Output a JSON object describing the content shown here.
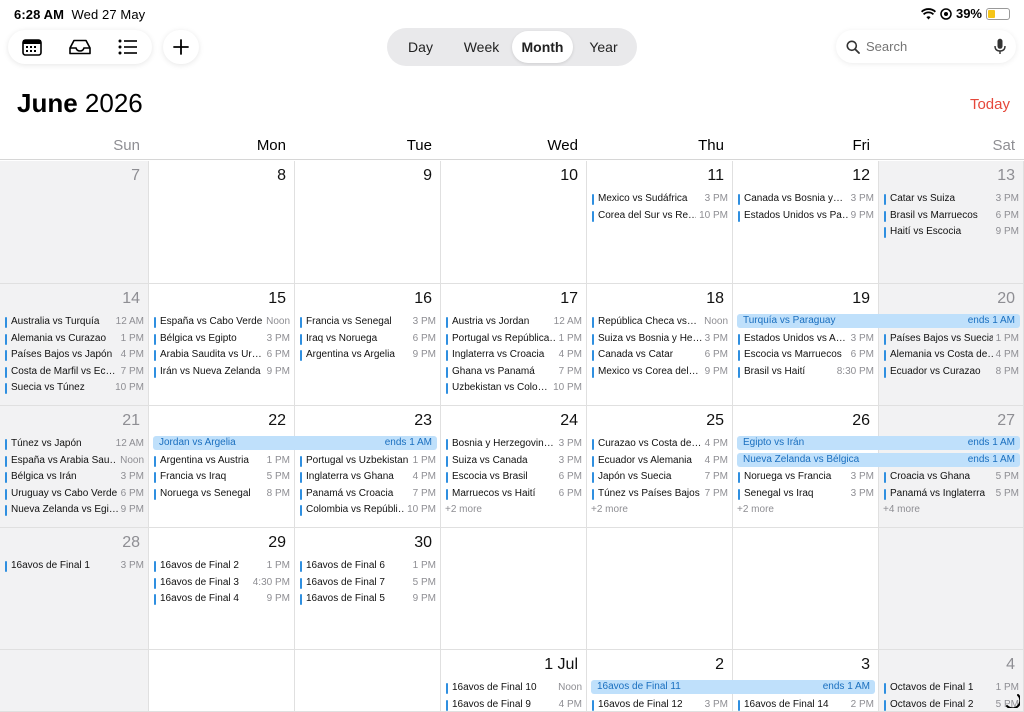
{
  "status_bar": {
    "time": "6:28 AM",
    "date": "Wed 27 May",
    "battery": "39%",
    "battery_level": 0.39
  },
  "toolbar": {
    "icons": [
      "calendar-icon",
      "inbox-icon",
      "list-icon"
    ],
    "add_icon": "plus-icon"
  },
  "view_switcher": {
    "options": [
      "Day",
      "Week",
      "Month",
      "Year"
    ],
    "selected": "Month"
  },
  "search": {
    "placeholder": "Search"
  },
  "header": {
    "month": "June",
    "year": "2026",
    "today_label": "Today"
  },
  "weekdays": [
    "Sun",
    "Mon",
    "Tue",
    "Wed",
    "Thu",
    "Fri",
    "Sat"
  ],
  "weeks": [
    {
      "days": [
        {
          "n": "7",
          "events": []
        },
        {
          "n": "8",
          "events": []
        },
        {
          "n": "9",
          "events": []
        },
        {
          "n": "10",
          "events": []
        },
        {
          "n": "11",
          "events": [
            {
              "t": "Mexico vs Sudáfrica",
              "tm": "3 PM"
            },
            {
              "t": "Corea del Sur vs Re…",
              "tm": "10 PM"
            }
          ]
        },
        {
          "n": "12",
          "events": [
            {
              "t": "Canada vs Bosnia y…",
              "tm": "3 PM"
            },
            {
              "t": "Estados Unidos vs Pa…",
              "tm": "9 PM"
            }
          ]
        },
        {
          "n": "13",
          "events": [
            {
              "t": "Catar vs Suiza",
              "tm": "3 PM"
            },
            {
              "t": "Brasil vs Marruecos",
              "tm": "6 PM"
            },
            {
              "t": "Haití vs Escocia",
              "tm": "9 PM"
            }
          ]
        }
      ],
      "spans": []
    },
    {
      "days": [
        {
          "n": "14",
          "events": [
            {
              "t": "Australia vs Turquía",
              "tm": "12 AM"
            },
            {
              "t": "Alemania vs Curazao",
              "tm": "1 PM"
            },
            {
              "t": "Países Bajos vs Japón",
              "tm": "4 PM"
            },
            {
              "t": "Costa de Marfil vs Ec…",
              "tm": "7 PM"
            },
            {
              "t": "Suecia vs Túnez",
              "tm": "10 PM"
            }
          ]
        },
        {
          "n": "15",
          "events": [
            {
              "t": "España vs Cabo Verde",
              "tm": "Noon"
            },
            {
              "t": "Bélgica vs Egipto",
              "tm": "3 PM"
            },
            {
              "t": "Arabia Saudita vs Ur…",
              "tm": "6 PM"
            },
            {
              "t": "Irán vs Nueva Zelanda",
              "tm": "9 PM"
            }
          ]
        },
        {
          "n": "16",
          "events": [
            {
              "t": "Francia vs Senegal",
              "tm": "3 PM"
            },
            {
              "t": "Iraq vs Noruega",
              "tm": "6 PM"
            },
            {
              "t": "Argentina vs Argelia",
              "tm": "9 PM"
            }
          ]
        },
        {
          "n": "17",
          "events": [
            {
              "t": "Austria vs Jordan",
              "tm": "12 AM"
            },
            {
              "t": "Portugal vs República…",
              "tm": "1 PM"
            },
            {
              "t": "Inglaterra vs Croacia",
              "tm": "4 PM"
            },
            {
              "t": "Ghana vs Panamá",
              "tm": "7 PM"
            },
            {
              "t": "Uzbekistan vs Colo…",
              "tm": "10 PM"
            }
          ]
        },
        {
          "n": "18",
          "events": [
            {
              "t": "República Checa vs…",
              "tm": "Noon"
            },
            {
              "t": "Suiza vs Bosnia y He…",
              "tm": "3 PM"
            },
            {
              "t": "Canada vs Catar",
              "tm": "6 PM"
            },
            {
              "t": "Mexico vs Corea del…",
              "tm": "9 PM"
            }
          ]
        },
        {
          "n": "19",
          "events": [
            {
              "t": "Estados Unidos vs A…",
              "tm": "3 PM"
            },
            {
              "t": "Escocia vs Marruecos",
              "tm": "6 PM"
            },
            {
              "t": "Brasil vs Haití",
              "tm": "8:30 PM"
            }
          ]
        },
        {
          "n": "20",
          "events": [
            {
              "t": "Países Bajos vs Suecia",
              "tm": "1 PM"
            },
            {
              "t": "Alemania vs Costa de…",
              "tm": "4 PM"
            },
            {
              "t": "Ecuador vs Curazao",
              "tm": "8 PM"
            }
          ]
        }
      ],
      "spans": [
        {
          "t": "Turquía vs Paraguay",
          "ends": "ends 1 AM",
          "from": 5,
          "to": 6,
          "row": 0
        }
      ]
    },
    {
      "days": [
        {
          "n": "21",
          "events": [
            {
              "t": "Túnez vs Japón",
              "tm": "12 AM"
            },
            {
              "t": "España vs Arabia Sau…",
              "tm": "Noon"
            },
            {
              "t": "Bélgica vs Irán",
              "tm": "3 PM"
            },
            {
              "t": "Uruguay vs Cabo Verde",
              "tm": "6 PM"
            },
            {
              "t": "Nueva Zelanda vs Egi…",
              "tm": "9 PM"
            }
          ]
        },
        {
          "n": "22",
          "events": [
            {
              "t": "Argentina vs Austria",
              "tm": "1 PM"
            },
            {
              "t": "Francia vs Iraq",
              "tm": "5 PM"
            },
            {
              "t": "Noruega vs Senegal",
              "tm": "8 PM"
            }
          ]
        },
        {
          "n": "23",
          "events": [
            {
              "t": "Portugal vs Uzbekistan",
              "tm": "1 PM"
            },
            {
              "t": "Inglaterra vs Ghana",
              "tm": "4 PM"
            },
            {
              "t": "Panamá vs Croacia",
              "tm": "7 PM"
            },
            {
              "t": "Colombia vs Repúbli…",
              "tm": "10 PM"
            }
          ]
        },
        {
          "n": "24",
          "events": [
            {
              "t": "Bosnia y Herzegovin…",
              "tm": "3 PM"
            },
            {
              "t": "Suiza vs Canada",
              "tm": "3 PM"
            },
            {
              "t": "Escocia vs Brasil",
              "tm": "6 PM"
            },
            {
              "t": "Marruecos vs Haití",
              "tm": "6 PM"
            }
          ],
          "more": "+2 more"
        },
        {
          "n": "25",
          "events": [
            {
              "t": "Curazao vs Costa de…",
              "tm": "4 PM"
            },
            {
              "t": "Ecuador vs Alemania",
              "tm": "4 PM"
            },
            {
              "t": "Japón vs Suecia",
              "tm": "7 PM"
            },
            {
              "t": "Túnez vs Países Bajos",
              "tm": "7 PM"
            }
          ],
          "more": "+2 more"
        },
        {
          "n": "26",
          "events": [
            {
              "t": "Noruega vs Francia",
              "tm": "3 PM"
            },
            {
              "t": "Senegal vs Iraq",
              "tm": "3 PM"
            }
          ],
          "more": "+2 more"
        },
        {
          "n": "27",
          "events": [
            {
              "t": "Croacia vs Ghana",
              "tm": "5 PM"
            },
            {
              "t": "Panamá vs Inglaterra",
              "tm": "5 PM"
            }
          ],
          "more": "+4 more"
        }
      ],
      "spans": [
        {
          "t": "Jordan vs Argelia",
          "ends": "ends 1 AM",
          "from": 1,
          "to": 2,
          "row": 0
        },
        {
          "t": "Egipto vs Irán",
          "ends": "ends 1 AM",
          "from": 5,
          "to": 6,
          "row": 0
        },
        {
          "t": "Nueva Zelanda vs Bélgica",
          "ends": "ends 1 AM",
          "from": 5,
          "to": 6,
          "row": 1
        }
      ]
    },
    {
      "days": [
        {
          "n": "28",
          "events": [
            {
              "t": "16avos de Final 1",
              "tm": "3 PM"
            }
          ]
        },
        {
          "n": "29",
          "events": [
            {
              "t": "16avos de Final 2",
              "tm": "1 PM"
            },
            {
              "t": "16avos de Final 3",
              "tm": "4:30 PM"
            },
            {
              "t": "16avos de Final 4",
              "tm": "9 PM"
            }
          ]
        },
        {
          "n": "30",
          "events": [
            {
              "t": "16avos de Final 6",
              "tm": "1 PM"
            },
            {
              "t": "16avos de Final 7",
              "tm": "5 PM"
            },
            {
              "t": "16avos de Final 5",
              "tm": "9 PM"
            }
          ]
        },
        {
          "n": "",
          "events": []
        },
        {
          "n": "",
          "events": []
        },
        {
          "n": "",
          "events": []
        },
        {
          "n": "",
          "events": []
        }
      ],
      "spans": []
    },
    {
      "days": [
        {
          "n": "",
          "events": []
        },
        {
          "n": "",
          "events": []
        },
        {
          "n": "",
          "events": []
        },
        {
          "n": "1 Jul",
          "events": [
            {
              "t": "16avos de Final 10",
              "tm": "Noon"
            },
            {
              "t": "16avos de Final 9",
              "tm": "4 PM"
            }
          ]
        },
        {
          "n": "2",
          "events": [
            {
              "t": "16avos de Final 12",
              "tm": "3 PM"
            }
          ]
        },
        {
          "n": "3",
          "events": [
            {
              "t": "16avos de Final 14",
              "tm": "2 PM"
            }
          ]
        },
        {
          "n": "4",
          "events": [
            {
              "t": "Octavos de Final 1",
              "tm": "1 PM"
            },
            {
              "t": "Octavos de Final 2",
              "tm": "5 PM"
            }
          ]
        }
      ],
      "spans": [
        {
          "t": "16avos de Final 11",
          "ends": "ends 1 AM",
          "from": 4,
          "to": 5,
          "row": 0
        }
      ]
    }
  ],
  "colors": {
    "accent": "#e5483b",
    "event_bar": "#2f8fe0",
    "span_bg": "#bfe0fb",
    "span_text": "#1a6fbf",
    "weekend_bg": "#f2f2f3"
  }
}
